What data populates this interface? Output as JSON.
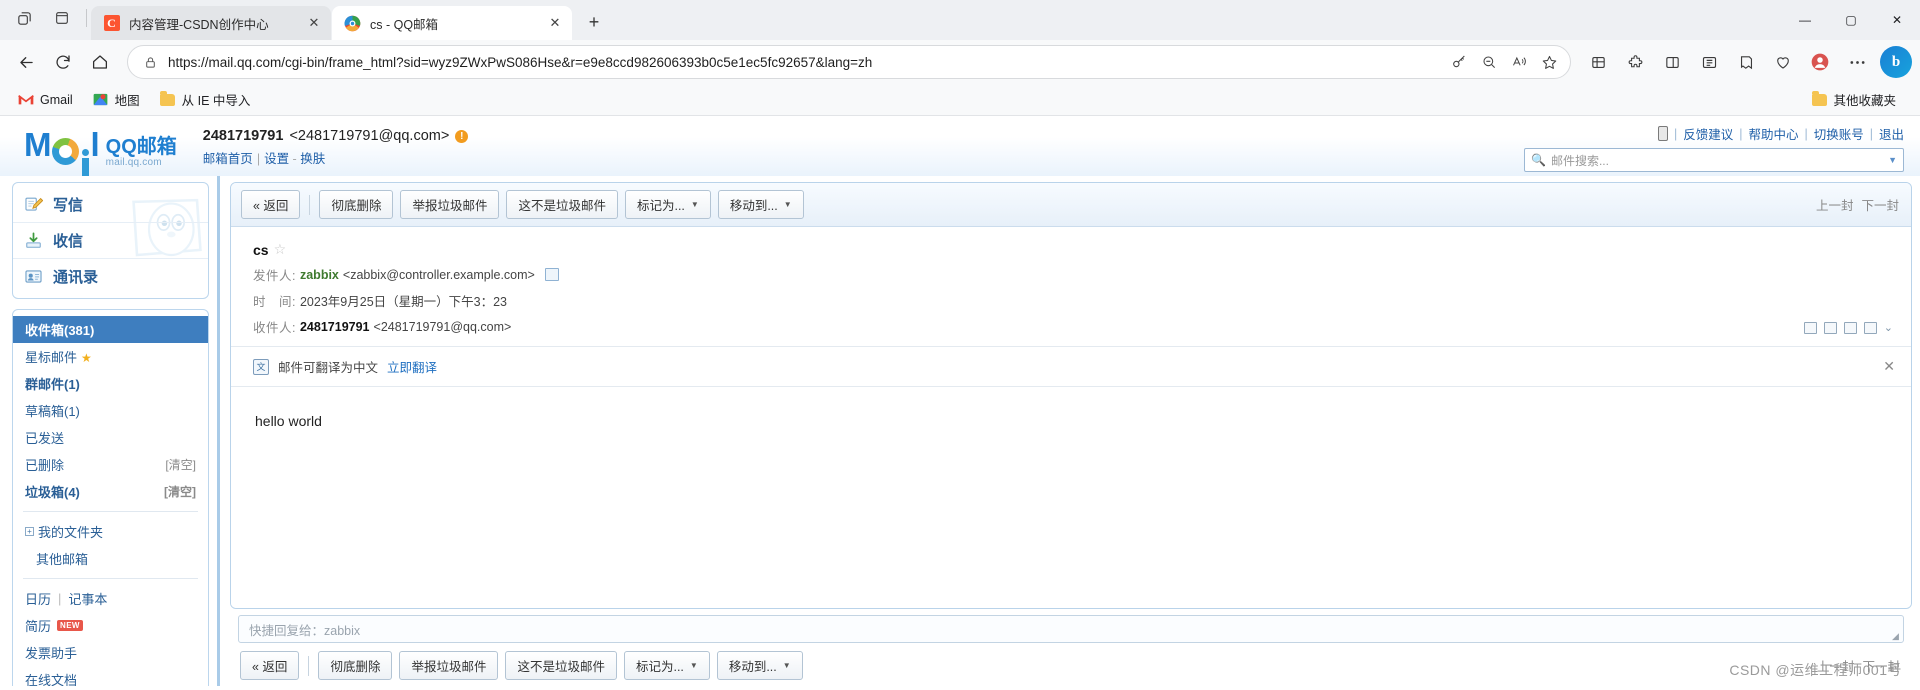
{
  "browser": {
    "tabs": [
      {
        "title": "内容管理-CSDN创作中心",
        "favicon": "csdn-icon",
        "active": false,
        "close_label": "✕"
      },
      {
        "title": "cs - QQ邮箱",
        "favicon": "qqmail-icon",
        "active": true,
        "close_label": "✕"
      }
    ],
    "new_tab_label": "+",
    "tab_actions_icon": "tab-search-icon",
    "tab_list_icon": "tab-list-icon",
    "window_controls": {
      "minimize": "—",
      "maximize": "▢",
      "close": "✕"
    },
    "nav": {
      "back_icon": "back-arrow-icon",
      "reload_icon": "reload-icon",
      "home_icon": "home-icon"
    },
    "omnibox": {
      "lock_icon": "lock-icon",
      "url": "https://mail.qq.com/cgi-bin/frame_html?sid=wyz9ZWxPwS086Hse&r=e9e8ccd982606393b0c5e1ec5fc92657&lang=zh",
      "icons": [
        "key-icon",
        "zoom-out-icon",
        "read-aloud-icon",
        "favorite-star-icon"
      ]
    },
    "toolbar_icons": [
      "collections-icon",
      "extensions-icon",
      "split-screen-icon",
      "sidebar-icon",
      "favorites-icon",
      "browser-essentials-icon",
      "profile-icon",
      "more-options-icon"
    ],
    "bing_label": "b",
    "bookmarks": [
      {
        "label": "Gmail",
        "icon": "gmail-icon"
      },
      {
        "label": "地图",
        "icon": "maps-icon"
      },
      {
        "label": "从 IE 中导入",
        "icon": "folder-icon"
      }
    ],
    "bookmarks_right": {
      "label": "其他收藏夹",
      "icon": "folder-icon"
    }
  },
  "qqmail": {
    "logo": {
      "mail_text": "Mail",
      "qq_main": "QQ邮箱",
      "qq_sub": "mail.qq.com"
    },
    "account": {
      "address": "2481719791<2481719791@qq.com>",
      "address_name": "2481719791",
      "address_rest": "<2481719791@qq.com>",
      "warn_icon": "warning-icon",
      "links": [
        "邮箱首页",
        "设置",
        "换肤"
      ]
    },
    "topright": {
      "phone_icon": "mobile-icon",
      "links": [
        "反馈建议",
        "帮助中心",
        "切换账号",
        "退出"
      ]
    },
    "search": {
      "placeholder": "邮件搜索...",
      "icon": "search-icon",
      "caret": "▼"
    },
    "sidebar": {
      "main": [
        {
          "label": "写信",
          "icon": "compose-icon"
        },
        {
          "label": "收信",
          "icon": "receive-icon"
        },
        {
          "label": "通讯录",
          "icon": "contacts-icon"
        }
      ],
      "folders": [
        {
          "label": "收件箱(381)",
          "active": true,
          "bold": true,
          "action": ""
        },
        {
          "label": "星标邮件",
          "active": false,
          "bold": false,
          "action": "",
          "star": "★"
        },
        {
          "label": "群邮件(1)",
          "active": false,
          "bold": true,
          "action": ""
        },
        {
          "label": "草稿箱(1)",
          "active": false,
          "bold": false,
          "action": ""
        },
        {
          "label": "已发送",
          "active": false,
          "bold": false,
          "action": ""
        },
        {
          "label": "已删除",
          "active": false,
          "bold": false,
          "action": "[清空]"
        },
        {
          "label": "垃圾箱(4)",
          "active": false,
          "bold": true,
          "action": "[清空]"
        }
      ],
      "myfolder": "我的文件夹",
      "otherbox": "其他邮箱",
      "tools": {
        "calendar": "日历",
        "notes": "记事本",
        "resume": "简历",
        "resume_badge": "NEW",
        "invoice": "发票助手",
        "docs": "在线文档"
      }
    },
    "toolbar": {
      "back": "« 返回",
      "delete": "彻底删除",
      "report_spam": "举报垃圾邮件",
      "not_spam": "这不是垃圾邮件",
      "mark_as": "标记为...",
      "move_to": "移动到...",
      "caret": "▼",
      "prev": "上一封",
      "next": "下一封"
    },
    "mail": {
      "subject": "cs",
      "star_icon": "star-outline-icon",
      "from_label": "发件人:",
      "from_name": "zabbix",
      "from_address": "<zabbix@controller.example.com>",
      "from_card_icon": "contact-card-icon",
      "time_label": "时　间:",
      "time_value": "2023年9月25日（星期一）下午3：23",
      "to_label": "收件人:",
      "to_value": "2481719791",
      "to_address": "<2481719791@qq.com>",
      "head_action_icons": [
        "forward-icon",
        "print-icon",
        "save-icon",
        "mail-icon",
        "more-icon"
      ],
      "translate_icon": "translate-icon",
      "translate_text": "邮件可翻译为中文",
      "translate_link": "立即翻译",
      "translate_close": "✕",
      "body": "hello world"
    },
    "reply": {
      "placeholder": "快捷回复给：zabbix",
      "grip_icon": "resize-grip-icon"
    },
    "watermark": "CSDN @运维工程师001号"
  }
}
